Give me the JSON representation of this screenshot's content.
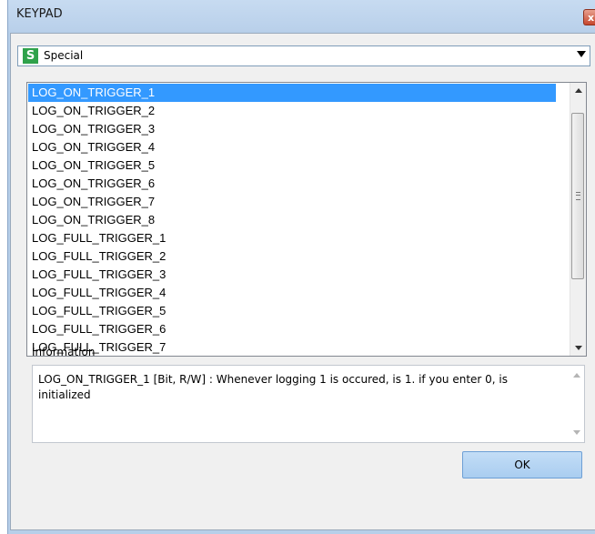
{
  "window": {
    "title": "KEYPAD",
    "close_glyph": "x"
  },
  "category_select": {
    "icon_letter": "S",
    "icon_color": "#2fa24b",
    "selected": "Special"
  },
  "list": {
    "items": [
      "LOG_ON_TRIGGER_1",
      "LOG_ON_TRIGGER_2",
      "LOG_ON_TRIGGER_3",
      "LOG_ON_TRIGGER_4",
      "LOG_ON_TRIGGER_5",
      "LOG_ON_TRIGGER_6",
      "LOG_ON_TRIGGER_7",
      "LOG_ON_TRIGGER_8",
      "LOG_FULL_TRIGGER_1",
      "LOG_FULL_TRIGGER_2",
      "LOG_FULL_TRIGGER_3",
      "LOG_FULL_TRIGGER_4",
      "LOG_FULL_TRIGGER_5",
      "LOG_FULL_TRIGGER_6",
      "LOG_FULL_TRIGGER_7"
    ],
    "selected_index": 0,
    "selection_color": "#3399ff"
  },
  "information": {
    "label": "Information",
    "text": "LOG_ON_TRIGGER_1 [Bit, R/W] : Whenever logging 1 is occured, is 1. if you enter 0, is initialized"
  },
  "buttons": {
    "ok_label": "OK"
  }
}
